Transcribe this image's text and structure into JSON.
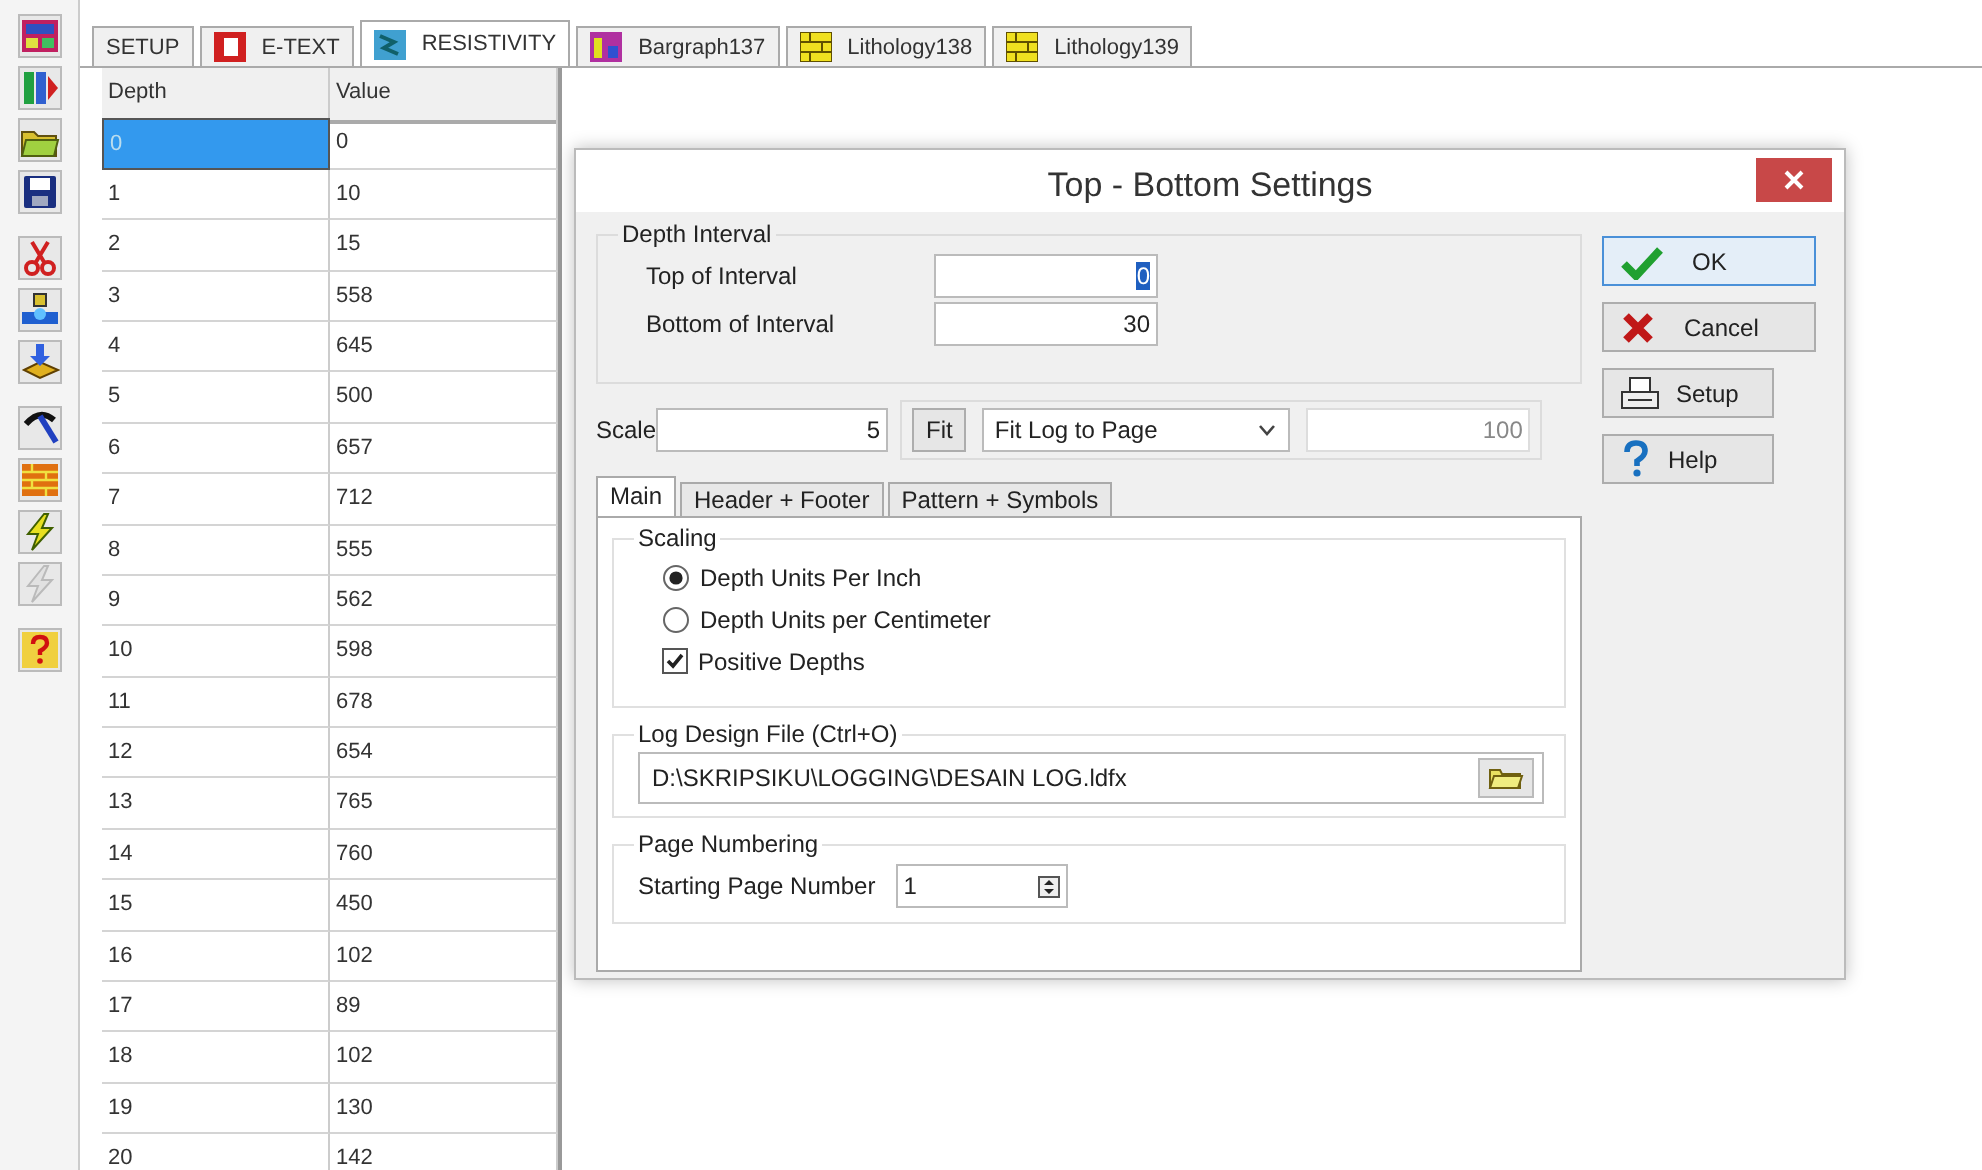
{
  "toolbar": [
    [
      {
        "kind": "palette",
        "disabled": false
      },
      {
        "kind": "columns",
        "disabled": false
      },
      {
        "kind": "folder",
        "disabled": false
      },
      {
        "kind": "save",
        "disabled": false
      }
    ],
    [
      {
        "kind": "scissors",
        "disabled": false
      },
      {
        "kind": "tool",
        "disabled": false
      },
      {
        "kind": "import",
        "disabled": false
      }
    ],
    [
      {
        "kind": "hammer",
        "disabled": false
      },
      {
        "kind": "bricks",
        "disabled": false
      },
      {
        "kind": "lightning",
        "disabled": false
      },
      {
        "kind": "lightning",
        "disabled": true
      }
    ],
    [
      {
        "kind": "help",
        "disabled": false
      }
    ]
  ],
  "tabs": [
    {
      "label": "SETUP",
      "kind": "plain",
      "selected": false
    },
    {
      "label": "E-TEXT",
      "kind": "text",
      "selected": false
    },
    {
      "label": "RESISTIVITY",
      "kind": "log",
      "selected": true
    },
    {
      "label": "Bargraph137",
      "kind": "bargraph",
      "selected": false
    },
    {
      "label": "Lithology138",
      "kind": "lithology",
      "selected": false
    },
    {
      "label": "Lithology139",
      "kind": "lithology",
      "selected": false
    }
  ],
  "grid": {
    "columns": [
      "Depth",
      "Value"
    ],
    "rows": [
      {
        "depth": "0",
        "value": "0",
        "selected": true
      },
      {
        "depth": "1",
        "value": "10",
        "selected": false
      },
      {
        "depth": "2",
        "value": "15",
        "selected": false
      },
      {
        "depth": "3",
        "value": "558",
        "selected": false
      },
      {
        "depth": "4",
        "value": "645",
        "selected": false
      },
      {
        "depth": "5",
        "value": "500",
        "selected": false
      },
      {
        "depth": "6",
        "value": "657",
        "selected": false
      },
      {
        "depth": "7",
        "value": "712",
        "selected": false
      },
      {
        "depth": "8",
        "value": "555",
        "selected": false
      },
      {
        "depth": "9",
        "value": "562",
        "selected": false
      },
      {
        "depth": "10",
        "value": "598",
        "selected": false
      },
      {
        "depth": "11",
        "value": "678",
        "selected": false
      },
      {
        "depth": "12",
        "value": "654",
        "selected": false
      },
      {
        "depth": "13",
        "value": "765",
        "selected": false
      },
      {
        "depth": "14",
        "value": "760",
        "selected": false
      },
      {
        "depth": "15",
        "value": "450",
        "selected": false
      },
      {
        "depth": "16",
        "value": "102",
        "selected": false
      },
      {
        "depth": "17",
        "value": "89",
        "selected": false
      },
      {
        "depth": "18",
        "value": "102",
        "selected": false
      },
      {
        "depth": "19",
        "value": "130",
        "selected": false
      },
      {
        "depth": "20",
        "value": "142",
        "selected": false
      }
    ]
  },
  "dialog": {
    "title": "Top - Bottom Settings",
    "depth_interval": {
      "legend": "Depth Interval",
      "fields": [
        {
          "label": "Top of Interval",
          "value": "0",
          "focused": true
        },
        {
          "label": "Bottom of Interval",
          "value": "30",
          "focused": false
        }
      ]
    },
    "scale": {
      "label": "Scale",
      "value": "5",
      "fit_button": "Fit",
      "mode": "Fit Log to Page",
      "page_value": "100",
      "page_value_disabled": true
    },
    "tabs": [
      {
        "label": "Main",
        "selected": true
      },
      {
        "label": "Header + Footer",
        "selected": false
      },
      {
        "label": "Pattern + Symbols",
        "selected": false
      }
    ],
    "scaling": {
      "legend": "Scaling",
      "options": [
        {
          "kind": "radio",
          "label": "Depth Units Per Inch",
          "checked": true
        },
        {
          "kind": "radio",
          "label": "Depth Units per Centimeter",
          "checked": false
        },
        {
          "kind": "checkbox",
          "label": "Positive Depths",
          "checked": true
        }
      ]
    },
    "log_design_file": {
      "legend": "Log Design File (Ctrl+O)",
      "value": "D:\\SKRIPSIKU\\LOGGING\\DESAIN LOG.ldfx"
    },
    "page_numbering": {
      "legend": "Page Numbering",
      "label": "Starting Page Number",
      "value": "1"
    },
    "buttons": [
      {
        "kind": "ok",
        "label": "OK",
        "focused": true
      },
      {
        "kind": "cancel",
        "label": "Cancel",
        "focused": false
      },
      {
        "kind": "setup",
        "label": "Setup",
        "focused": false
      },
      {
        "kind": "help",
        "label": "Help",
        "focused": false
      }
    ]
  }
}
